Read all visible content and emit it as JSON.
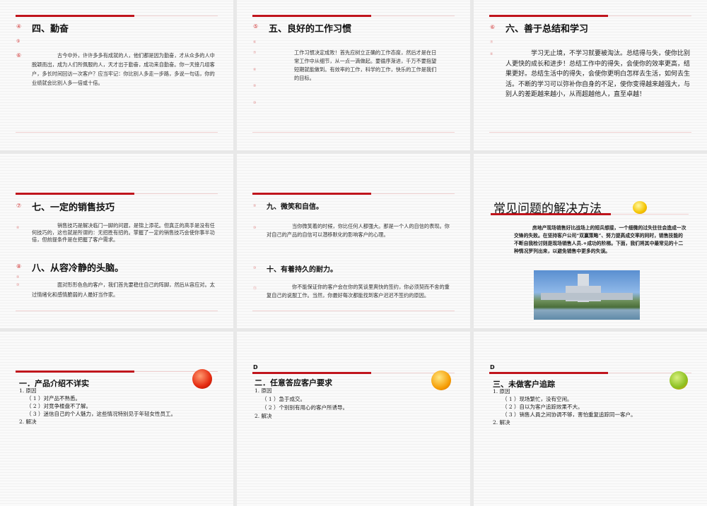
{
  "slides": [
    {
      "title": "四、勤奋",
      "bullets": [
        "④",
        "⑤",
        "⑥"
      ],
      "body": "古今中外，许许多多有成就的人，他们都是因为勤奋，才从众多的人中脱颖而出，成为人们所佩服的人，天才出于勤奋，成功来自勤奋。你一天接几组客户，多长时间回访一次客户？应当牢记：你比别人多走一步路，多说一句话，你的业绩就会比别人多一倍或十倍。"
    },
    {
      "title": "五、良好的工作习惯",
      "bullets": [
        "⑤",
        "⑥",
        "⑦",
        "⑧",
        "⑨",
        "⑩"
      ],
      "paras": [
        "工作习惯决定成败！首先应树立正确的工作态度，然后才是在日",
        "常工作中从细节，从一点一滴做起。要循序渐进，千万不要指望",
        "短期就能做到。有效率的工作，科学的工作，快乐的工作是我们",
        "的目标。"
      ]
    },
    {
      "title": "六、善于总结和学习",
      "bullets": [
        "⑥",
        "⑦",
        "⑧"
      ],
      "body": "学习无止境，不学习就要被淘汰。总结得与失，使你比别人更快的成长和进步！总结工作中的得失，会使你的效率更高，结果更好。总结生活中的得失，会使你更明白怎样去生活，如何去生活。不断的学习可以弥补你自身的不足，使你变得越来越强大，与别人的差距越来越小，从而超越他人，直至卓越！"
    },
    {
      "title": "七、一定的销售技巧",
      "title2": "八、从容冷静的头脑。",
      "bullets": [
        "⑦",
        "⑧",
        "⑧",
        "⑨",
        "⑩"
      ],
      "body": "销售技巧是解决临门一脚的问题，是锦上添花。但真正的高手是没有任何技巧的，这也就是所谓的：无招胜有招的。掌握了一定的销售技巧会使你事半功倍，但前提条件是在把握了客户需求。",
      "body2": "面对形形色色的客户，我们首先要稳住自己的阵脚，然后从容应对。太过情绪化和感情脆弱的人最好当作家。"
    },
    {
      "title": "九、微笑和自信。",
      "title2": "十、有着持久的耐力。",
      "bullets": [
        "⑨",
        "⑩",
        "⑩",
        "⑪"
      ],
      "body": "当你微笑着的时候，你比任何人都强大。那是一个人的自信的表现。你对自己的产品的自信可以潜移默化的影响客户的心理。",
      "body2": "你不能保证你的客户会在你的笑谈里爽快的签约，你必须契而不舍的重复自己的说服工作。当然，你最好每次都能找到客户迟迟不签约的原因。"
    },
    {
      "title": "常见问题的解决方法",
      "body": "房地产现场销售好比战场上的短兵想接，一个细微的过失往往会造成一次交锋的失败。在坚持客户公司“双赢策略”、努力提高成交率的同时，销售技能的不断自我检讨则是现场销售人员.+成功的阶梯。下面，我们将其中最常见的十二种情况罗列出来，以避免销售中更多的失误。"
    },
    {
      "title": "一．产品介绍不详实",
      "lines": [
        "1. 原因",
        "（ 1 ）对产品不熟悉。",
        "（ 2 ）对竞争楼盘不了解。",
        "（ 3 ）迷信自己的个人魅力，这些情况特别见于年轻女性员工。",
        "2. 解决"
      ]
    },
    {
      "label": "D",
      "title": "二．任意答应客户要求",
      "lines": [
        "1. 原因",
        "（ 1 ）急于成交。",
        "（ 2 ）个别别有用心的客户所诱导。",
        "2. 解决"
      ]
    },
    {
      "label": "D",
      "title": "三、未做客户追踪",
      "lines": [
        "1. 原因",
        "（ 1 ）现场繁忙，没有空闲。",
        "（ 2 ）自以为客户追踪效果不大。",
        "（ 3 ）销售人員之间协调不够，害怕重复追踪同一客户。",
        "2. 解决"
      ]
    }
  ],
  "colors": {
    "accent": "#c0141c",
    "bullet": "#d03030"
  }
}
